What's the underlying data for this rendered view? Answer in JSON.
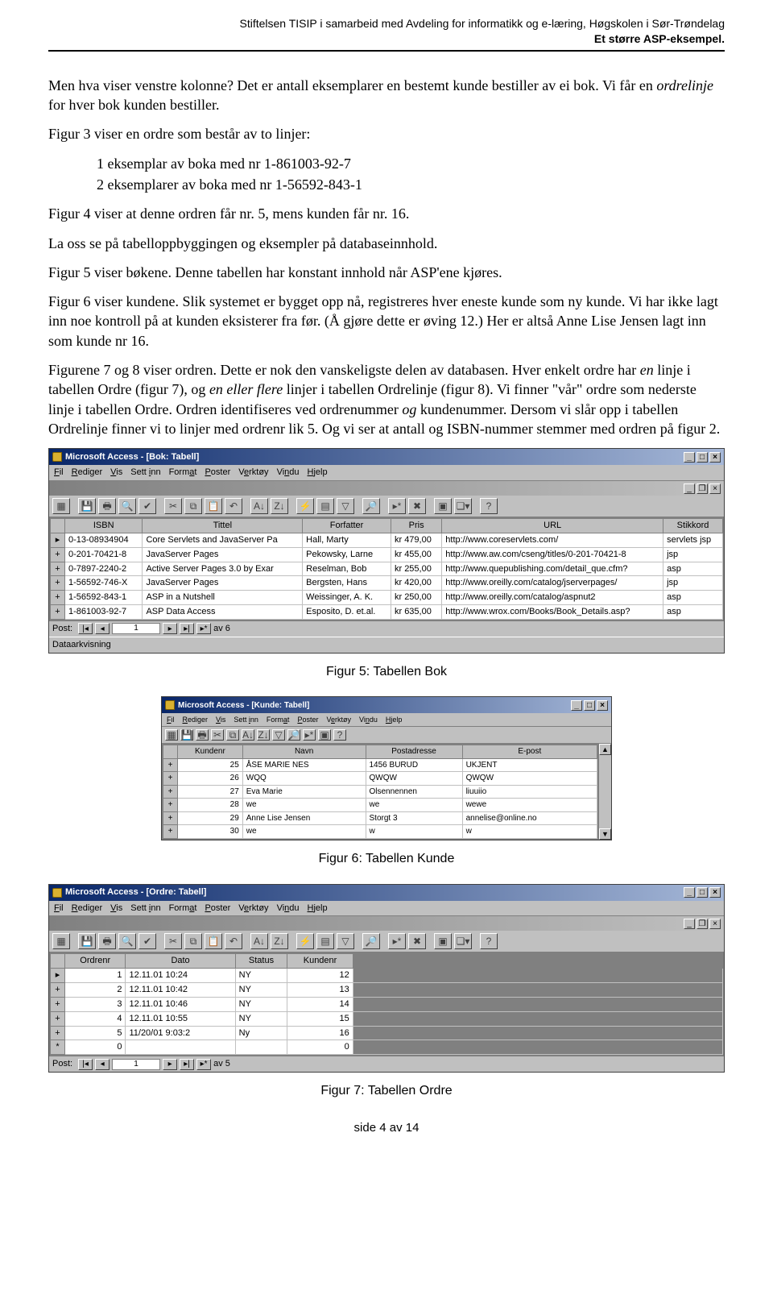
{
  "header": {
    "line1": "Stiftelsen TISIP i samarbeid med Avdeling for informatikk og e-læring, Høgskolen i Sør-Trøndelag",
    "line2": "Et større ASP-eksempel."
  },
  "body": {
    "p1a": "Men hva viser venstre kolonne? Det er antall eksemplarer en bestemt kunde bestiller av ei bok. Vi får en ",
    "p1_italic": "ordrelinje",
    "p1b": " for hver bok kunden bestiller.",
    "p2": "Figur 3 viser en ordre som består av to linjer:",
    "li1": "1 eksemplar av boka med nr 1-861003-92-7",
    "li2": "2 eksemplarer av boka med nr 1-56592-843-1",
    "p3": "Figur 4 viser at denne ordren får nr. 5, mens kunden får nr. 16.",
    "p4": "La oss se på tabelloppbyggingen og eksempler på databaseinnhold.",
    "p5": "Figur 5 viser bøkene. Denne tabellen har konstant innhold når ASP'ene kjøres.",
    "p6": "Figur 6 viser kundene. Slik systemet er bygget opp nå, registreres hver eneste kunde som ny kunde. Vi har ikke lagt inn noe kontroll på at kunden eksisterer fra før. (Å gjøre dette er øving 12.) Her er altså Anne Lise Jensen lagt inn som kunde nr 16.",
    "p7a": "Figurene 7 og 8 viser ordren. Dette er nok den vanskeligste delen av databasen. Hver enkelt ordre har ",
    "p7_it1": "en",
    "p7b": " linje i tabellen Ordre (figur 7), og ",
    "p7_it2": "en eller flere",
    "p7c": " linjer i tabellen Ordrelinje (figur 8). Vi finner \"vår\" ordre som nederste linje i tabellen Ordre. Ordren identifiseres ved ordrenummer ",
    "p7_it3": "og",
    "p7d": " kundenummer. Dersom vi slår opp i tabellen Ordrelinje finner vi to linjer med ordrenr lik 5. Og vi ser at antall og ISBN-nummer stemmer med ordren på figur 2."
  },
  "captions": {
    "fig5": "Figur 5: Tabellen Bok",
    "fig6": "Figur 6: Tabellen Kunde",
    "fig7": "Figur 7: Tabellen Ordre"
  },
  "footer": "side 4 av 14",
  "access": {
    "menus": [
      "Fil",
      "Rediger",
      "Vis",
      "Sett inn",
      "Format",
      "Poster",
      "Verktøy",
      "Vindu",
      "Hjelp"
    ],
    "nav_label": "Post:",
    "status": "Dataarkvisning",
    "bok": {
      "title": "Microsoft Access - [Bok: Tabell]",
      "nav_value": "1",
      "nav_total": "av  6",
      "cols": [
        "ISBN",
        "Tittel",
        "Forfatter",
        "Pris",
        "URL",
        "Stikkord"
      ],
      "rows": [
        [
          "0-13-08934904",
          "Core Servlets and JavaServer Pa",
          "Hall, Marty",
          "kr 479,00",
          "http://www.coreservlets.com/",
          "servlets jsp"
        ],
        [
          "0-201-70421-8",
          "JavaServer Pages",
          "Pekowsky, Larne",
          "kr 455,00",
          "http://www.aw.com/cseng/titles/0-201-70421-8",
          "jsp"
        ],
        [
          "0-7897-2240-2",
          "Active Server Pages 3.0 by Exar",
          "Reselman, Bob",
          "kr 255,00",
          "http://www.quepublishing.com/detail_que.cfm?",
          "asp"
        ],
        [
          "1-56592-746-X",
          "JavaServer Pages",
          "Bergsten, Hans",
          "kr 420,00",
          "http://www.oreilly.com/catalog/jserverpages/",
          "jsp"
        ],
        [
          "1-56592-843-1",
          "ASP in a Nutshell",
          "Weissinger, A. K.",
          "kr 250,00",
          "http://www.oreilly.com/catalog/aspnut2",
          "asp"
        ],
        [
          "1-861003-92-7",
          "ASP Data Access",
          "Esposito, D. et.al.",
          "kr 635,00",
          "http://www.wrox.com/Books/Book_Details.asp?",
          "asp"
        ]
      ]
    },
    "kunde": {
      "title": "Microsoft Access - [Kunde: Tabell]",
      "cols": [
        "Kundenr",
        "Navn",
        "Postadresse",
        "E-post"
      ],
      "rows": [
        [
          "25",
          "ÅSE MARIE NES",
          "1456 BURUD",
          "UKJENT"
        ],
        [
          "26",
          "WQQ",
          "QWQW",
          "QWQW"
        ],
        [
          "27",
          "Eva Marie",
          "Olsennennen",
          "liuuiio"
        ],
        [
          "28",
          "we",
          "we",
          "wewe"
        ],
        [
          "29",
          "Anne Lise Jensen",
          "Storgt 3",
          "annelise@online.no"
        ],
        [
          "30",
          "we",
          "w",
          "w"
        ]
      ]
    },
    "ordre": {
      "title": "Microsoft Access - [Ordre: Tabell]",
      "nav_value": "1",
      "nav_total": "av 5",
      "cols": [
        "Ordrenr",
        "Dato",
        "Status",
        "Kundenr"
      ],
      "rows": [
        [
          "1",
          "12.11.01 10:24",
          "NY",
          "12"
        ],
        [
          "2",
          "12.11.01 10:42",
          "NY",
          "13"
        ],
        [
          "3",
          "12.11.01 10:46",
          "NY",
          "14"
        ],
        [
          "4",
          "12.11.01 10:55",
          "NY",
          "15"
        ],
        [
          "5",
          "11/20/01 9:03:2",
          "Ny",
          "16"
        ],
        [
          "0",
          "",
          "",
          "0"
        ]
      ]
    }
  }
}
